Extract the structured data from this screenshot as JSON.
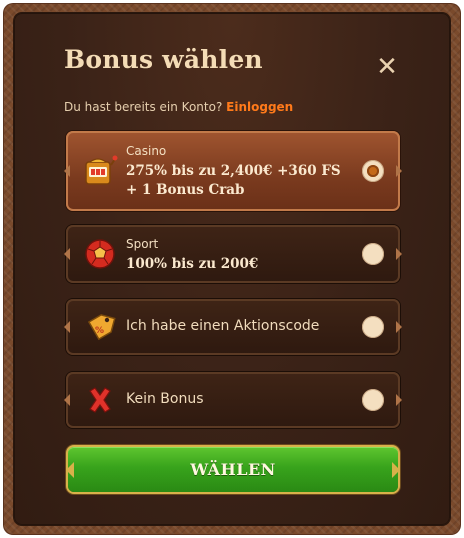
{
  "dialog": {
    "title": "Bonus wählen",
    "close_glyph": "✕",
    "account_prompt": "Du hast bereits ein Konto?",
    "login_link": "Einloggen"
  },
  "options": [
    {
      "icon": "slot-machine-icon",
      "category": "Casino",
      "line1": "275% bis zu 2,400€ +360 FS",
      "line2": "+ 1 Bonus Crab",
      "selected": true
    },
    {
      "icon": "sport-ball-icon",
      "category": "Sport",
      "line1": "100% bis zu 200€",
      "selected": false
    },
    {
      "icon": "promo-tag-icon",
      "label": "Ich habe einen Aktionscode",
      "selected": false
    },
    {
      "icon": "red-x-icon",
      "label": "Kein Bonus",
      "selected": false
    }
  ],
  "submit": {
    "label": "WÄHLEN"
  },
  "colors": {
    "accent_link": "#ff7a1a",
    "selected_option": "#9a5230",
    "button_green": "#38a31c",
    "button_border": "#d8b14a"
  }
}
